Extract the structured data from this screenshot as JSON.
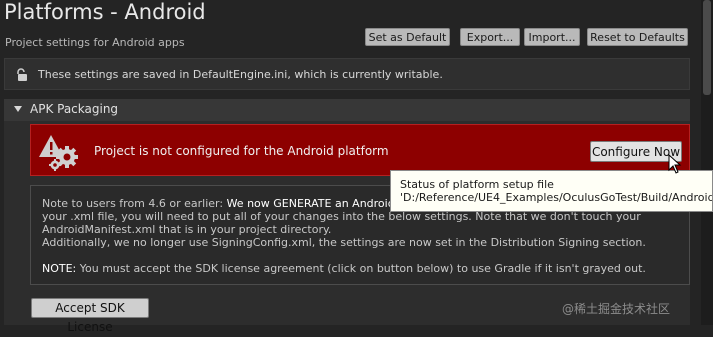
{
  "header": {
    "title": "Platforms - Android",
    "subtitle": "Project settings for Android apps",
    "buttons": {
      "set_default": "Set as Default",
      "export": "Export...",
      "import": "Import...",
      "reset": "Reset to Defaults"
    }
  },
  "info_bar": {
    "icon": "unlock-icon",
    "text": "These settings are saved in DefaultEngine.ini, which is currently writable."
  },
  "section": {
    "title": "APK Packaging",
    "expanded": true
  },
  "banner": {
    "icon": "gear-warning-icon",
    "message": "Project is not configured for the Android platform",
    "configure_label": "Configure Now",
    "color": "#8d0000"
  },
  "tooltip": {
    "line1": "Status of platform setup file",
    "line2": "'D:/Reference/UE4_Examples/OculusGoTest/Build/Android/"
  },
  "note": {
    "line1_prefix": "Note to users from 4.6 or earlier:",
    "line1_a": " We now ",
    "line1_generate": "GENERATE",
    "line1_b": " an AndroidMa",
    "line2": "your .xml file, you will need to put all of your changes into the below settings. Note that we don't touch your",
    "line3": "AndroidManifest.xml that is in your project directory.",
    "line4": "Additionally, we no longer use SigningConfig.xml, the settings are now set in the Distribution Signing section.",
    "line5_prefix": "NOTE:",
    "line5_rest": " You must accept the SDK license agreement (click on button below) to use Gradle if it isn't grayed out."
  },
  "accept_button": "Accept SDK License",
  "watermark": "@稀土掘金技术社区"
}
